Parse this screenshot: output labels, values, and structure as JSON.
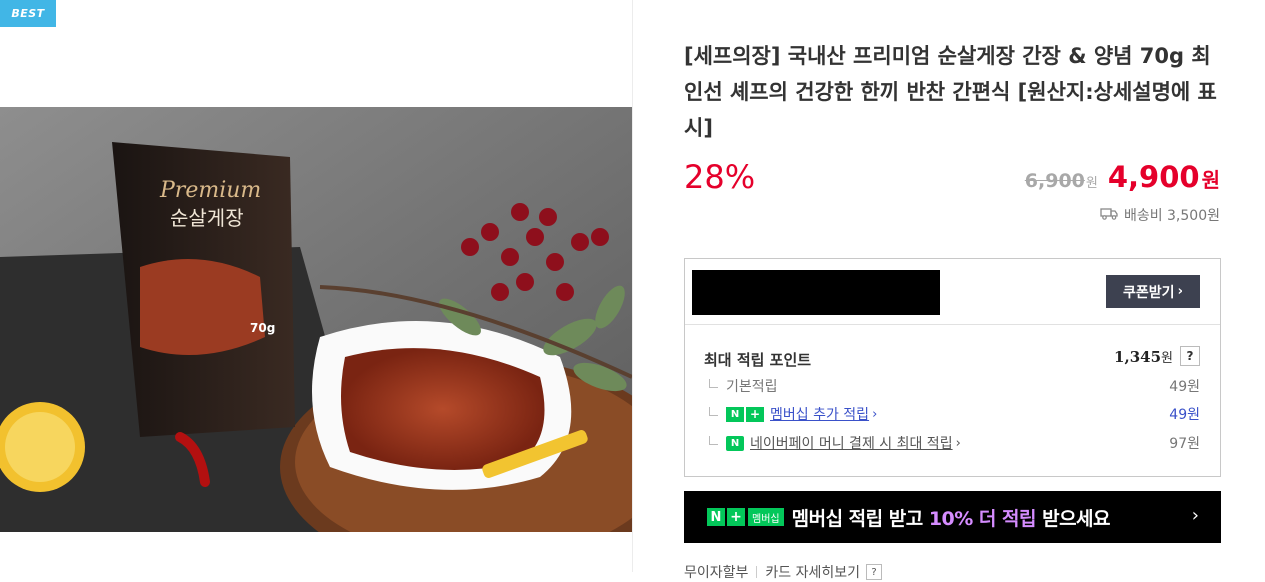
{
  "badge": {
    "label": "BEST"
  },
  "product": {
    "title": "[세프의장] 국내산 프리미엄 순살게장 간장 & 양념 70g 최인선 셰프의 건강한 한끼 반찬 간편식 [원산지:상세설명에 표시]",
    "discount": "28%",
    "original_price": "6,900",
    "original_unit": "원",
    "sale_price": "4,900",
    "sale_unit": "원",
    "delivery": "배송비 3,500원",
    "image_alt": "순살게장 Premium 70g 파우치와 양념게장 접시"
  },
  "package_text": {
    "brand": "Premium",
    "name": "순살게장",
    "weight": "70g"
  },
  "coupon": {
    "button_label": "쿠폰받기",
    "chevron": "›"
  },
  "points": {
    "header": "최대 적립 포인트",
    "total": "1,345",
    "total_unit": "원",
    "help": "?",
    "rows": [
      {
        "label": "기본적립",
        "value": "49원"
      },
      {
        "badge_n": "N",
        "badge_plus": "+",
        "label": "멤버십 추가 적립",
        "value": "49원"
      },
      {
        "badge_pay": "N",
        "label": "네이버페이 머니 결제 시 최대 적립",
        "value": "97원"
      }
    ]
  },
  "membership_banner": {
    "n": "N",
    "plus": "+",
    "membership": "멤버십",
    "text_1": "멤버십 적립 받고 ",
    "highlight": "10% 더 적립",
    "text_2": " 받으세요",
    "arrow": "›"
  },
  "bottom": {
    "item_1": "무이자할부",
    "item_2": "카드 자세히보기",
    "help": "?"
  },
  "colors": {
    "accent_red": "#e5002b",
    "naver_green": "#03c75a",
    "best_blue": "#41b6e6",
    "link_blue": "#3a51c9",
    "highlight_purple": "#d58cff"
  },
  "icons": {
    "delivery": "truck-icon",
    "chevron": "chevron-right-icon"
  }
}
